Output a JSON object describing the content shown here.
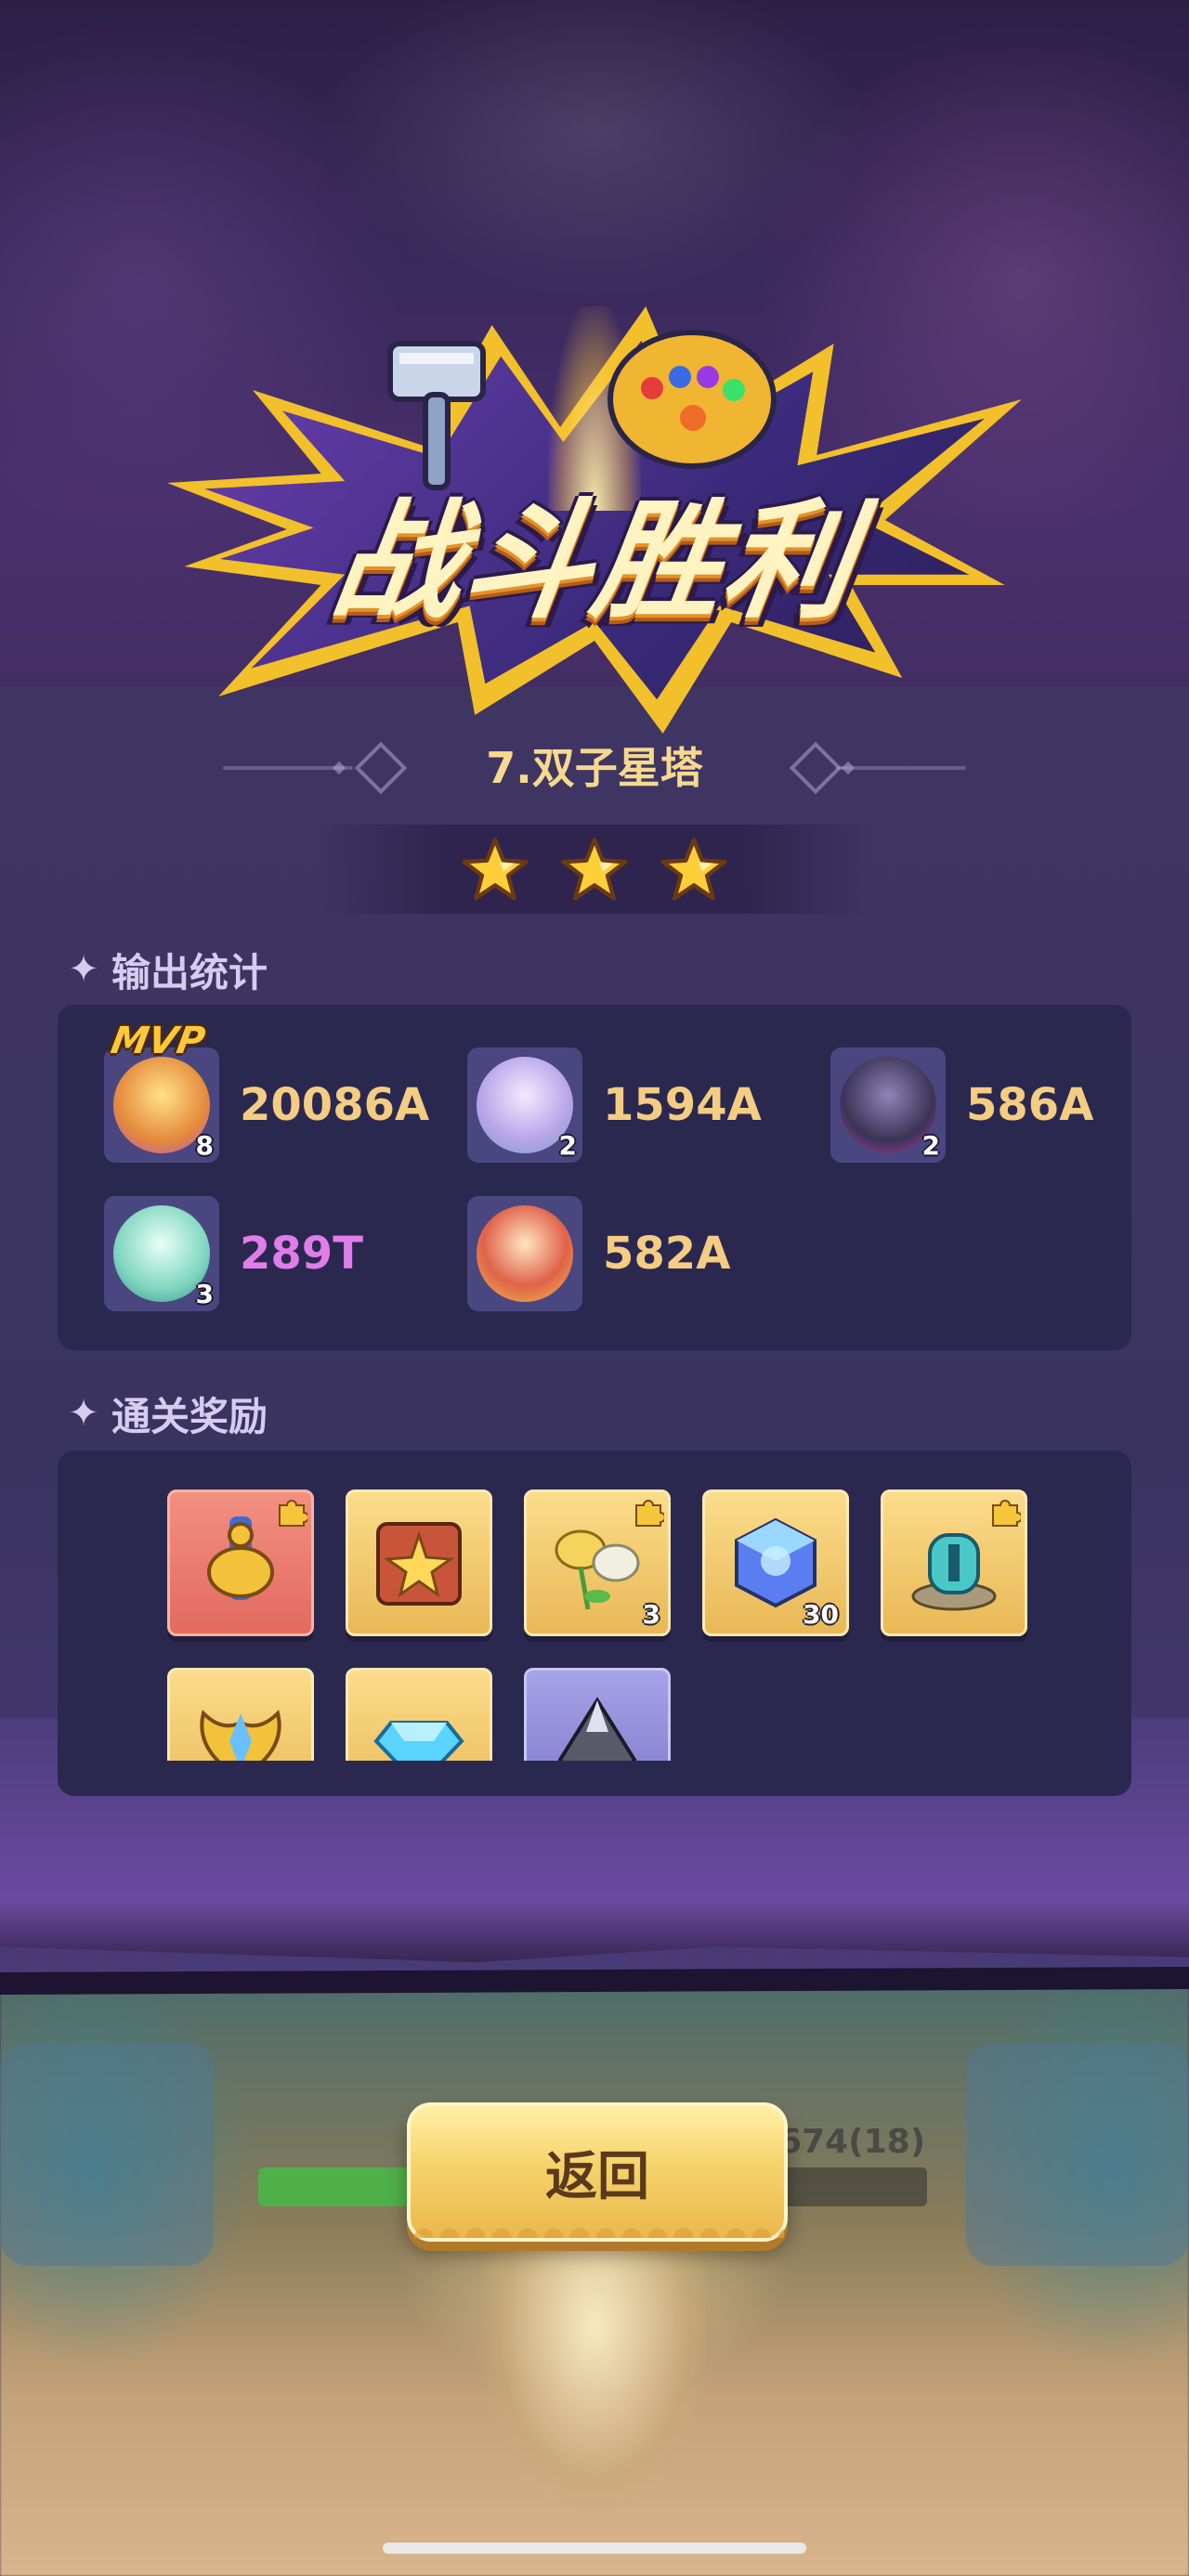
{
  "banner": {
    "title": "战斗胜利"
  },
  "level": {
    "name": "7.双子星塔",
    "stars": 3
  },
  "damage_section": {
    "title": "输出统计",
    "mvp_label": "MVP",
    "heroes": [
      {
        "level": "8",
        "damage": "20086A",
        "mvp": true,
        "color": "#f4cd83"
      },
      {
        "level": "2",
        "damage": "1594A",
        "mvp": false,
        "color": "#f4cd83"
      },
      {
        "level": "2",
        "damage": "586A",
        "mvp": false,
        "color": "#f4cd83"
      },
      {
        "level": "3",
        "damage": "289T",
        "mvp": false,
        "color": "#e07de8"
      },
      {
        "level": "",
        "damage": "582A",
        "mvp": false,
        "color": "#f4cd83"
      }
    ]
  },
  "rewards_section": {
    "title": "通关奖励",
    "items": [
      {
        "icon": "bell-scroll-icon",
        "count": ""
      },
      {
        "icon": "star-book-icon",
        "count": ""
      },
      {
        "icon": "lotus-flower-icon",
        "count": "3"
      },
      {
        "icon": "blue-cube-icon",
        "count": "30"
      },
      {
        "icon": "tower-shrine-icon",
        "count": ""
      },
      {
        "icon": "winged-badge-icon",
        "count": ""
      },
      {
        "icon": "diamond-gem-icon",
        "count": ""
      },
      {
        "icon": "dark-crystal-icon",
        "count": ""
      }
    ]
  },
  "scene": {
    "hp_text": "674(18)"
  },
  "actions": {
    "back_label": "返回"
  }
}
